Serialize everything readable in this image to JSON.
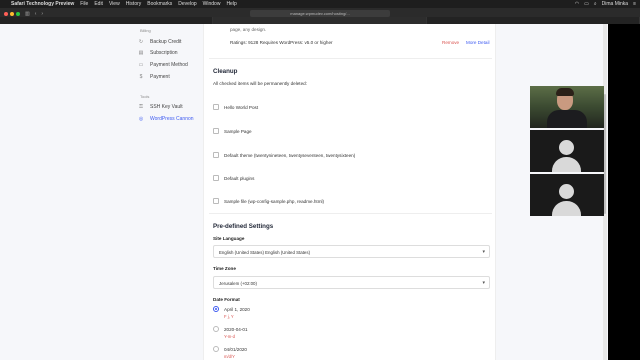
{
  "menubar": {
    "app": "Safari Technology Preview",
    "items": [
      "File",
      "Edit",
      "View",
      "History",
      "Bookmarks",
      "Develop",
      "Window",
      "Help"
    ],
    "user": "Dima Minka"
  },
  "browser": {
    "url": "manage.wpmudev.com/hosting/..."
  },
  "sidebar": {
    "billing_heading": "Billing",
    "billing_items": [
      {
        "label": "Backup Credit",
        "icon": "backup-icon"
      },
      {
        "label": "Subscription",
        "icon": "subscription-icon"
      },
      {
        "label": "Payment Method",
        "icon": "card-icon"
      },
      {
        "label": "Payment",
        "icon": "payment-icon"
      }
    ],
    "tools_heading": "Tools",
    "tools_items": [
      {
        "label": "SSH Key Vault",
        "icon": "key-icon"
      },
      {
        "label": "WordPress Cannon",
        "icon": "cannon-icon"
      }
    ]
  },
  "plugin_row": {
    "partial": "page, any design.",
    "meta": "Ratings: 9128   Requires WordPress: v5.0 or higher",
    "remove": "Remove",
    "more": "More Detail"
  },
  "cleanup": {
    "title": "Cleanup",
    "desc": "All checked items will be permanently deleted:",
    "items": [
      "Hello World Post",
      "Sample Page",
      "Default theme (twentynineteen, twentyseventeen, twentysixteen)",
      "Default plugins",
      "Sample file (wp-config-sample.php, readme.html)"
    ]
  },
  "predefined": {
    "title": "Pre-defined Settings",
    "site_language_label": "Site Language",
    "site_language_value": "English (United States) English (United States)",
    "timezone_label": "Time Zone",
    "timezone_value": "Jerusalem (+02:00)",
    "date_format_label": "Date Format",
    "date_formats": [
      {
        "label": "April 1, 2020",
        "code": "F j, Y",
        "selected": true
      },
      {
        "label": "2020-04-01",
        "code": "Y-m-d",
        "selected": false
      },
      {
        "label": "04/01/2020",
        "code": "m/d/Y",
        "selected": false
      }
    ]
  },
  "colors": {
    "accent": "#3d5af1",
    "danger": "#d9534f"
  }
}
